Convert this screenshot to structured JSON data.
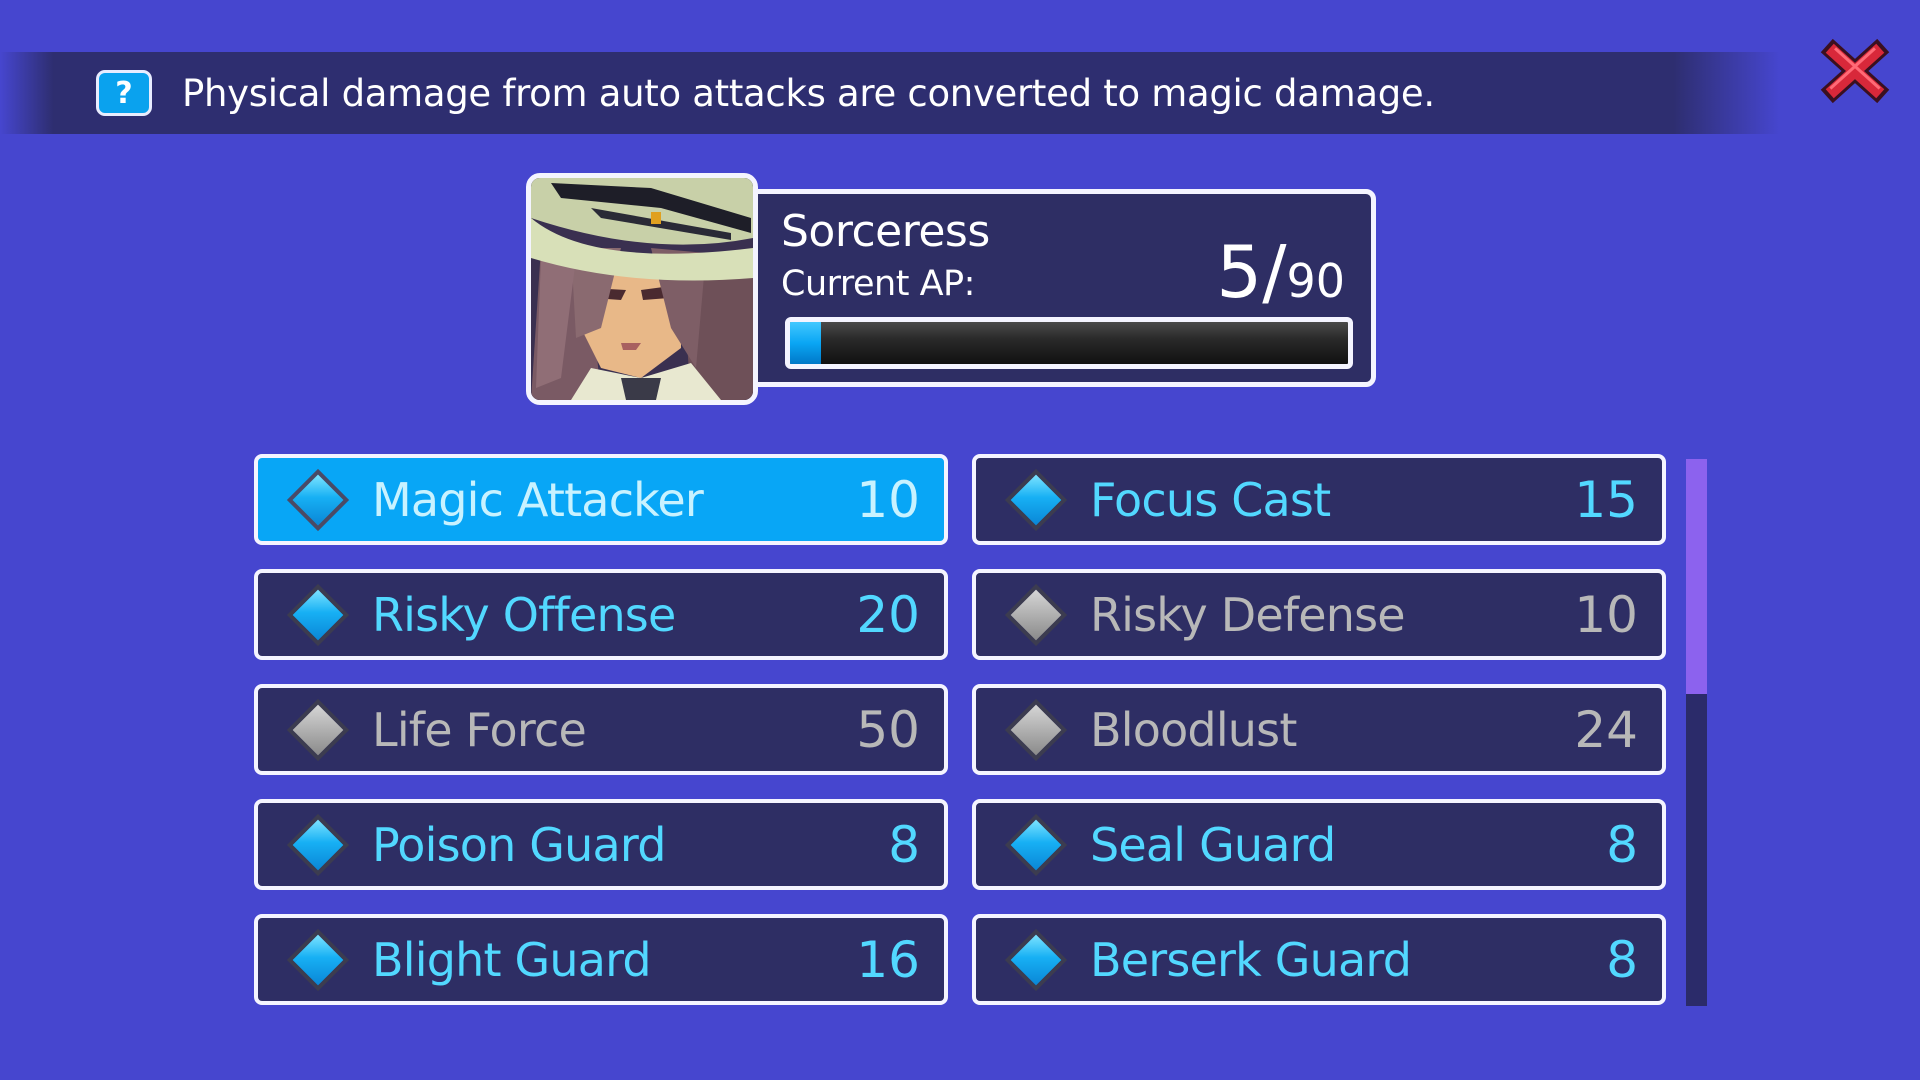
{
  "tooltip": {
    "help_icon": "?",
    "text": "Physical damage from auto attacks are converted to magic damage."
  },
  "close_icon": "close-x-icon",
  "character": {
    "name": "Sorceress",
    "ap_label": "Current AP:",
    "ap_current": "5",
    "ap_separator": "/",
    "ap_max": "90",
    "ap_fraction": 0.0556
  },
  "skills": [
    {
      "name": "Magic Attacker",
      "cost": "10",
      "state": "selected"
    },
    {
      "name": "Focus Cast",
      "cost": "15",
      "state": "learned"
    },
    {
      "name": "Risky Offense",
      "cost": "20",
      "state": "learned"
    },
    {
      "name": "Risky Defense",
      "cost": "10",
      "state": "locked"
    },
    {
      "name": "Life Force",
      "cost": "50",
      "state": "locked"
    },
    {
      "name": "Bloodlust",
      "cost": "24",
      "state": "locked"
    },
    {
      "name": "Poison Guard",
      "cost": "8",
      "state": "learned"
    },
    {
      "name": "Seal Guard",
      "cost": "8",
      "state": "learned"
    },
    {
      "name": "Blight Guard",
      "cost": "16",
      "state": "learned"
    },
    {
      "name": "Berserk Guard",
      "cost": "8",
      "state": "learned"
    }
  ],
  "scroll": {
    "thumb_fraction": 0.43
  },
  "colors": {
    "background": "#4646cf",
    "panel": "#2e2e64",
    "selected": "#08a6f6",
    "learned_text": "#52d8ff",
    "locked_text": "#b8b8b8",
    "scroll_thumb": "#8c62ee"
  }
}
